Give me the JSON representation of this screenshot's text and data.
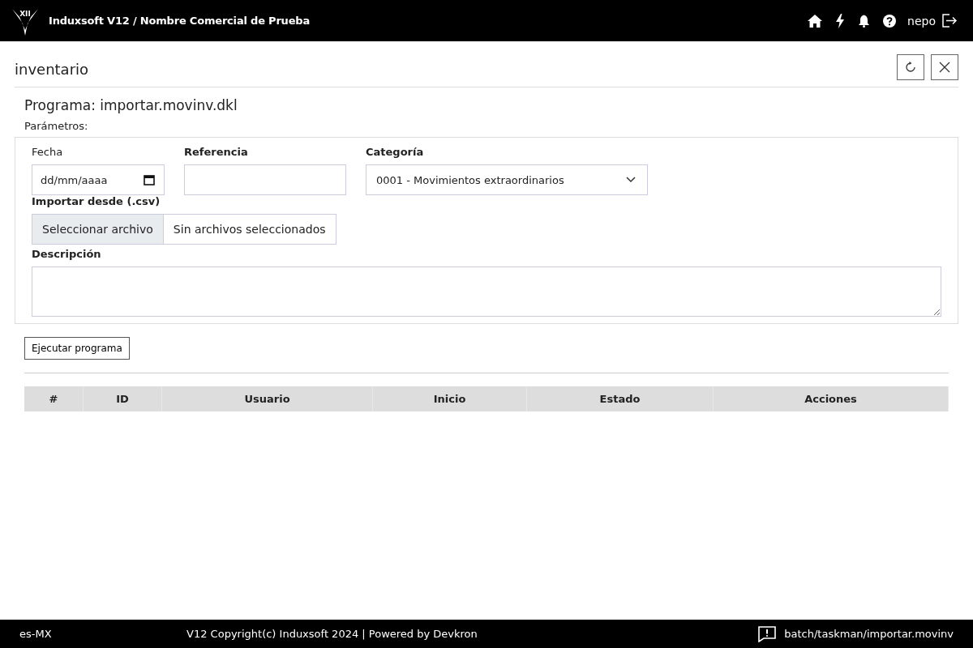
{
  "header": {
    "logo_text": "XII",
    "title": "Induxsoft V12 / Nombre Comercial de Prueba",
    "user": "nepo"
  },
  "panel": {
    "title": "inventario"
  },
  "program": {
    "title": "Programa: importar.movinv.dkl",
    "params_label": "Parámetros:"
  },
  "form": {
    "fecha": {
      "label": "Fecha",
      "placeholder": "dd/mm/aaaa"
    },
    "referencia": {
      "label": "Referencia"
    },
    "categoria": {
      "label": "Categoría",
      "value": "0001 - Movimientos extraordinarios"
    },
    "importar": {
      "label": "Importar desde (.csv)",
      "button": "Seleccionar archivo",
      "status": "Sin archivos seleccionados"
    },
    "descripcion": {
      "label": "Descripción"
    }
  },
  "run_button": "Ejecutar programa",
  "table": {
    "columns": [
      "#",
      "ID",
      "Usuario",
      "Inicio",
      "Estado",
      "Acciones"
    ]
  },
  "status_bar": {
    "locale": "es-MX",
    "copyright": "V12 Copyright(c) Induxsoft 2024 | Powered by Devkron",
    "path": "batch/taskman/importar.movinv"
  }
}
